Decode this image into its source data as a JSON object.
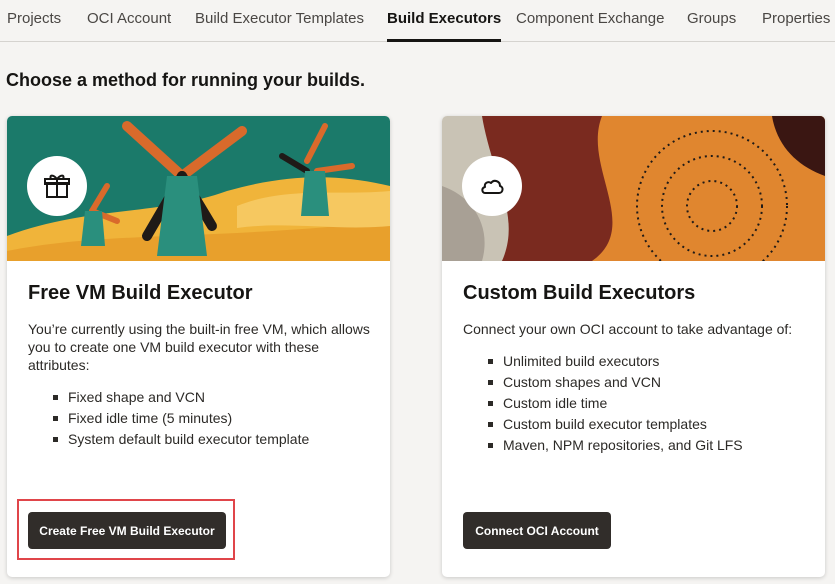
{
  "tabs": [
    {
      "label": "Projects",
      "active": false
    },
    {
      "label": "OCI Account",
      "active": false
    },
    {
      "label": "Build Executor Templates",
      "active": false
    },
    {
      "label": "Build Executors",
      "active": true
    },
    {
      "label": "Component Exchange",
      "active": false
    },
    {
      "label": "Groups",
      "active": false
    },
    {
      "label": "Properties",
      "active": false
    }
  ],
  "heading": "Choose a method for running your builds.",
  "cards": [
    {
      "icon": "gift-icon",
      "title": "Free VM Build Executor",
      "description": "You’re currently using the built-in free VM, which allows you to create one VM build executor with these attributes:",
      "items": [
        "Fixed shape and VCN",
        "Fixed idle time (5 minutes)",
        "System default build executor template"
      ],
      "button": "Create Free VM Build Executor"
    },
    {
      "icon": "cloud-icon",
      "title": "Custom Build Executors",
      "description": "Connect your own OCI account to take advantage of:",
      "items": [
        "Unlimited build executors",
        "Custom shapes and VCN",
        "Custom idle time",
        "Custom build executor templates",
        "Maven, NPM repositories, and Git LFS"
      ],
      "button": "Connect OCI Account"
    }
  ],
  "colors": {
    "accent": "#312d2a",
    "highlight": "#e0454a",
    "teal": "#1b7a6a",
    "orange": "#e0862f"
  }
}
